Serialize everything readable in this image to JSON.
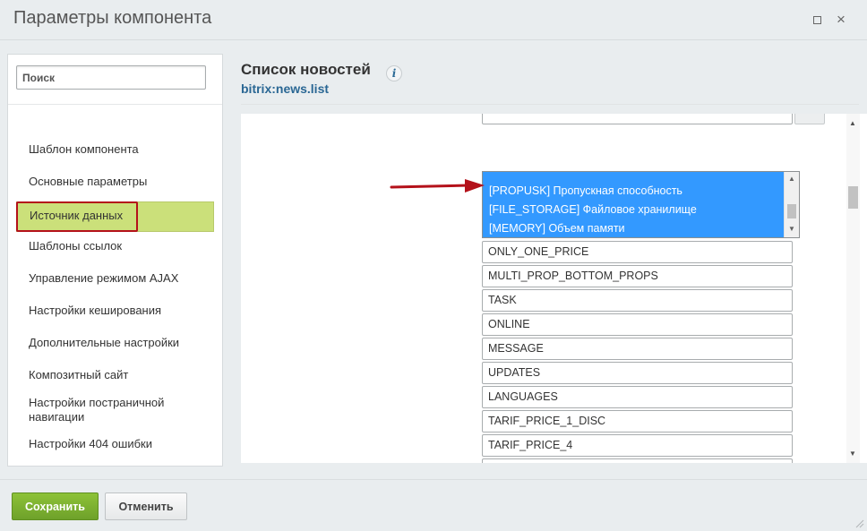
{
  "window": {
    "title": "Параметры компонента",
    "maximize_icon": "maximize-icon",
    "close_icon": "close-icon",
    "close_glyph": "×"
  },
  "sidebar": {
    "search_placeholder": "Поиск",
    "items": [
      {
        "label": "Шаблон компонента",
        "active": false
      },
      {
        "label": "Основные параметры",
        "active": false
      },
      {
        "label": "Источник данных",
        "active": true
      },
      {
        "label": "Шаблоны ссылок",
        "active": false
      },
      {
        "label": "Управление режимом AJAX",
        "active": false
      },
      {
        "label": "Настройки кеширования",
        "active": false
      },
      {
        "label": "Дополнительные настройки",
        "active": false
      },
      {
        "label": "Композитный сайт",
        "active": false
      },
      {
        "label": "Настройки постраничной навигации",
        "active": false
      },
      {
        "label": "Настройки 404 ошибки",
        "active": false
      }
    ]
  },
  "component": {
    "title": "Список новостей",
    "code": "bitrix:news.list",
    "info_icon": "info-icon",
    "info_glyph": "i"
  },
  "multiselect": {
    "options": [
      "[PROPUSK] Пропускная способность",
      "[FILE_STORAGE] Файловое хранилище",
      "[MEMORY] Объем памяти"
    ],
    "selected": [
      0,
      1,
      2
    ]
  },
  "fields": [
    "ONLY_ONE_PRICE",
    "MULTI_PROP_BOTTOM_PROPS",
    "TASK",
    "ONLINE",
    "MESSAGE",
    "UPDATES",
    "LANGUAGES",
    "TARIF_PRICE_1_DISC",
    "TARIF_PRICE_4"
  ],
  "footer": {
    "save_label": "Сохранить",
    "cancel_label": "Отменить"
  },
  "colors": {
    "accent_green": "#cbe07a",
    "highlight_red": "#b4111a",
    "selection_blue": "#3399ff",
    "link_blue": "#2a6794"
  }
}
